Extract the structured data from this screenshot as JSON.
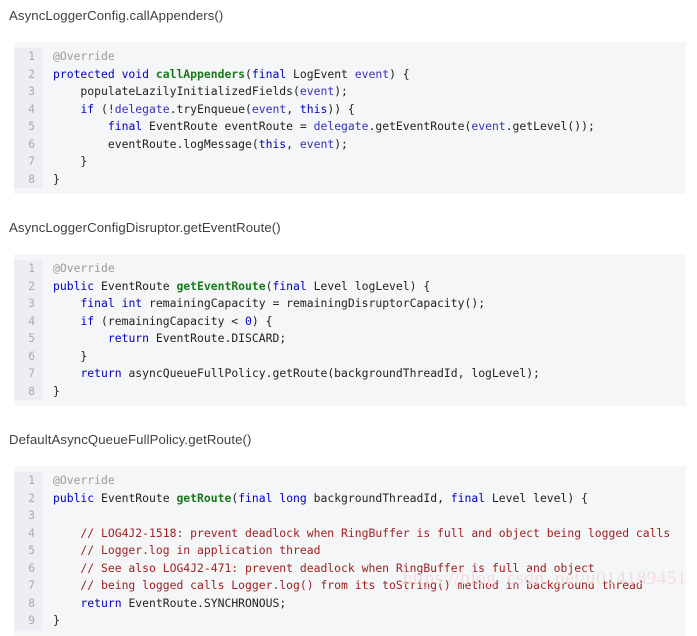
{
  "page": {
    "background": "#ffffff",
    "code_background": "#f5f6f8",
    "gutter_background": "#eceef1",
    "keyword_color": "#0000c0",
    "method_color": "#1a7a1a",
    "comment_color": "#9f2020",
    "annotation_color": "#9a9a9a",
    "heading_color": "#3f3f3f"
  },
  "watermark": {
    "text": "https://blog. csdn. net/u014189451"
  },
  "sections": [
    {
      "title": "AsyncLoggerConfig.callAppenders()",
      "lines": [
        {
          "no": "1",
          "tokens": [
            {
              "t": "@Override",
              "c": "a"
            }
          ]
        },
        {
          "no": "2",
          "tokens": [
            {
              "t": "protected void ",
              "c": "k"
            },
            {
              "t": "callAppenders",
              "c": "m"
            },
            {
              "t": "(",
              "c": "t"
            },
            {
              "t": "final",
              "c": "k"
            },
            {
              "t": " LogEvent ",
              "c": "t"
            },
            {
              "t": "event",
              "c": "f"
            },
            {
              "t": ") {",
              "c": "t"
            }
          ]
        },
        {
          "no": "3",
          "tokens": [
            {
              "t": "    populateLazilyInitializedFields(",
              "c": "t"
            },
            {
              "t": "event",
              "c": "f"
            },
            {
              "t": ");",
              "c": "t"
            }
          ]
        },
        {
          "no": "4",
          "tokens": [
            {
              "t": "    ",
              "c": "t"
            },
            {
              "t": "if",
              "c": "k"
            },
            {
              "t": " (!",
              "c": "t"
            },
            {
              "t": "delegate",
              "c": "f"
            },
            {
              "t": ".tryEnqueue(",
              "c": "t"
            },
            {
              "t": "event",
              "c": "f"
            },
            {
              "t": ", ",
              "c": "t"
            },
            {
              "t": "this",
              "c": "k"
            },
            {
              "t": ")) {",
              "c": "t"
            }
          ]
        },
        {
          "no": "5",
          "tokens": [
            {
              "t": "        ",
              "c": "t"
            },
            {
              "t": "final",
              "c": "k"
            },
            {
              "t": " EventRoute eventRoute = ",
              "c": "t"
            },
            {
              "t": "delegate",
              "c": "f"
            },
            {
              "t": ".getEventRoute(",
              "c": "t"
            },
            {
              "t": "event",
              "c": "f"
            },
            {
              "t": ".getLevel());",
              "c": "t"
            }
          ]
        },
        {
          "no": "6",
          "tokens": [
            {
              "t": "        eventRoute.logMessage(",
              "c": "t"
            },
            {
              "t": "this",
              "c": "k"
            },
            {
              "t": ", ",
              "c": "t"
            },
            {
              "t": "event",
              "c": "f"
            },
            {
              "t": ");",
              "c": "t"
            }
          ]
        },
        {
          "no": "7",
          "tokens": [
            {
              "t": "    }",
              "c": "t"
            }
          ]
        },
        {
          "no": "8",
          "tokens": [
            {
              "t": "}",
              "c": "t"
            }
          ]
        }
      ]
    },
    {
      "title": "AsyncLoggerConfigDisruptor.getEventRoute()",
      "lines": [
        {
          "no": "1",
          "tokens": [
            {
              "t": "@Override",
              "c": "a"
            }
          ]
        },
        {
          "no": "2",
          "tokens": [
            {
              "t": "public",
              "c": "k"
            },
            {
              "t": " EventRoute ",
              "c": "t"
            },
            {
              "t": "getEventRoute",
              "c": "m"
            },
            {
              "t": "(",
              "c": "t"
            },
            {
              "t": "final",
              "c": "k"
            },
            {
              "t": " Level logLevel) {",
              "c": "t"
            }
          ]
        },
        {
          "no": "3",
          "tokens": [
            {
              "t": "    ",
              "c": "t"
            },
            {
              "t": "final int",
              "c": "k"
            },
            {
              "t": " remainingCapacity = remainingDisruptorCapacity();",
              "c": "t"
            }
          ]
        },
        {
          "no": "4",
          "tokens": [
            {
              "t": "    ",
              "c": "t"
            },
            {
              "t": "if",
              "c": "k"
            },
            {
              "t": " (remainingCapacity < ",
              "c": "t"
            },
            {
              "t": "0",
              "c": "n"
            },
            {
              "t": ") {",
              "c": "t"
            }
          ]
        },
        {
          "no": "5",
          "tokens": [
            {
              "t": "        ",
              "c": "t"
            },
            {
              "t": "return",
              "c": "k"
            },
            {
              "t": " EventRoute.DISCARD;",
              "c": "t"
            }
          ]
        },
        {
          "no": "6",
          "tokens": [
            {
              "t": "    }",
              "c": "t"
            }
          ]
        },
        {
          "no": "7",
          "tokens": [
            {
              "t": "    ",
              "c": "t"
            },
            {
              "t": "return",
              "c": "k"
            },
            {
              "t": " asyncQueueFullPolicy.getRoute(backgroundThreadId, logLevel);",
              "c": "t"
            }
          ]
        },
        {
          "no": "8",
          "tokens": [
            {
              "t": "}",
              "c": "t"
            }
          ]
        }
      ]
    },
    {
      "title": "DefaultAsyncQueueFullPolicy.getRoute()",
      "lines": [
        {
          "no": "1",
          "tokens": [
            {
              "t": "@Override",
              "c": "a"
            }
          ]
        },
        {
          "no": "2",
          "tokens": [
            {
              "t": "public",
              "c": "k"
            },
            {
              "t": " EventRoute ",
              "c": "t"
            },
            {
              "t": "getRoute",
              "c": "m"
            },
            {
              "t": "(",
              "c": "t"
            },
            {
              "t": "final long",
              "c": "k"
            },
            {
              "t": " backgroundThreadId, ",
              "c": "t"
            },
            {
              "t": "final",
              "c": "k"
            },
            {
              "t": " Level level) {",
              "c": "t"
            }
          ]
        },
        {
          "no": "3",
          "tokens": [
            {
              "t": "",
              "c": "t"
            }
          ]
        },
        {
          "no": "4",
          "tokens": [
            {
              "t": "    // LOG4J2-1518: prevent deadlock when RingBuffer is full and object being logged calls",
              "c": "c"
            }
          ]
        },
        {
          "no": "5",
          "tokens": [
            {
              "t": "    // Logger.log in application thread",
              "c": "c"
            }
          ]
        },
        {
          "no": "6",
          "tokens": [
            {
              "t": "    // See also LOG4J2-471: prevent deadlock when RingBuffer is full and object",
              "c": "c"
            }
          ]
        },
        {
          "no": "7",
          "tokens": [
            {
              "t": "    // being logged calls Logger.log() from its toString() method in background thread",
              "c": "c"
            }
          ]
        },
        {
          "no": "8",
          "tokens": [
            {
              "t": "    ",
              "c": "t"
            },
            {
              "t": "return",
              "c": "k"
            },
            {
              "t": " EventRoute.SYNCHRONOUS;",
              "c": "t"
            }
          ]
        },
        {
          "no": "9",
          "tokens": [
            {
              "t": "}",
              "c": "t"
            }
          ]
        }
      ]
    }
  ]
}
